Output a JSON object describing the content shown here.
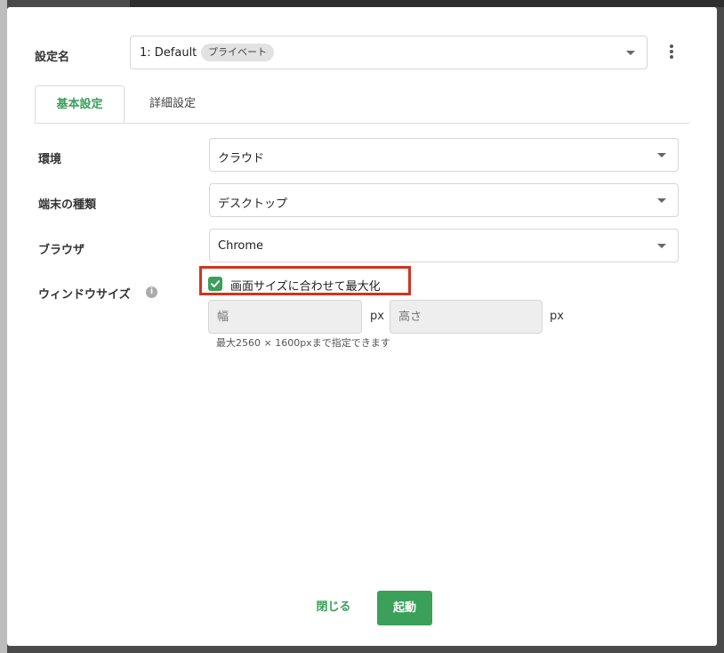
{
  "settings": {
    "label": "設定名",
    "preset_value": "1: Default",
    "preset_badge": "プライベート"
  },
  "tabs": [
    {
      "label": "基本設定",
      "active": true
    },
    {
      "label": "詳細設定",
      "active": false
    }
  ],
  "form": {
    "environment": {
      "label": "環境",
      "value": "クラウド"
    },
    "device": {
      "label": "端末の種類",
      "value": "デスクトップ"
    },
    "browser": {
      "label": "ブラウザ",
      "value": "Chrome"
    },
    "window_size": {
      "label": "ウィンドウサイズ",
      "info_glyph": "i",
      "maximize_label": "画面サイズに合わせて最大化",
      "maximize_checked": true,
      "width_placeholder": "幅",
      "height_placeholder": "高さ",
      "unit": "px",
      "hint": "最大2560 × 1600pxまで指定できます"
    }
  },
  "footer": {
    "close_label": "閉じる",
    "start_label": "起動"
  },
  "colors": {
    "accent": "#3aa05a",
    "highlight": "#d0341f"
  },
  "icons": [
    "chevron-down-icon",
    "kebab-menu-icon",
    "info-icon",
    "checkmark-icon"
  ]
}
